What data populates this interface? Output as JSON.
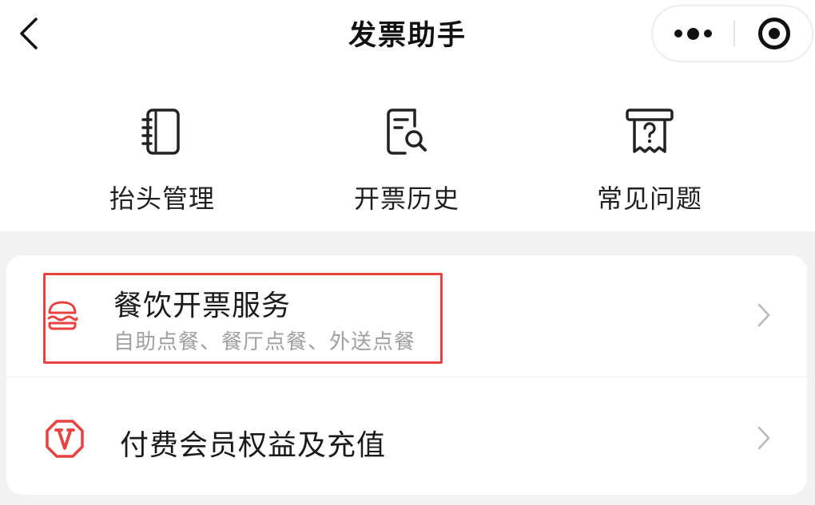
{
  "nav": {
    "title": "发票助手",
    "back_icon": "chevron-left-icon",
    "more_icon": "more-dots-icon",
    "close_icon": "target-close-icon"
  },
  "shortcuts": [
    {
      "label": "抬头管理",
      "icon": "notebook-icon"
    },
    {
      "label": "开票历史",
      "icon": "document-search-icon"
    },
    {
      "label": "常见问题",
      "icon": "receipt-question-icon"
    }
  ],
  "list": [
    {
      "title": "餐饮开票服务",
      "subtitle": "自助点餐、餐厅点餐、外送点餐",
      "icon": "burger-icon"
    },
    {
      "title": "付费会员权益及充值",
      "icon": "v-badge-icon"
    }
  ],
  "colors": {
    "accent_red": "#e8413f",
    "background": "#f2f2f2",
    "subtitle_gray": "#a0a0a0",
    "chevron_gray": "#b8b8b8"
  }
}
